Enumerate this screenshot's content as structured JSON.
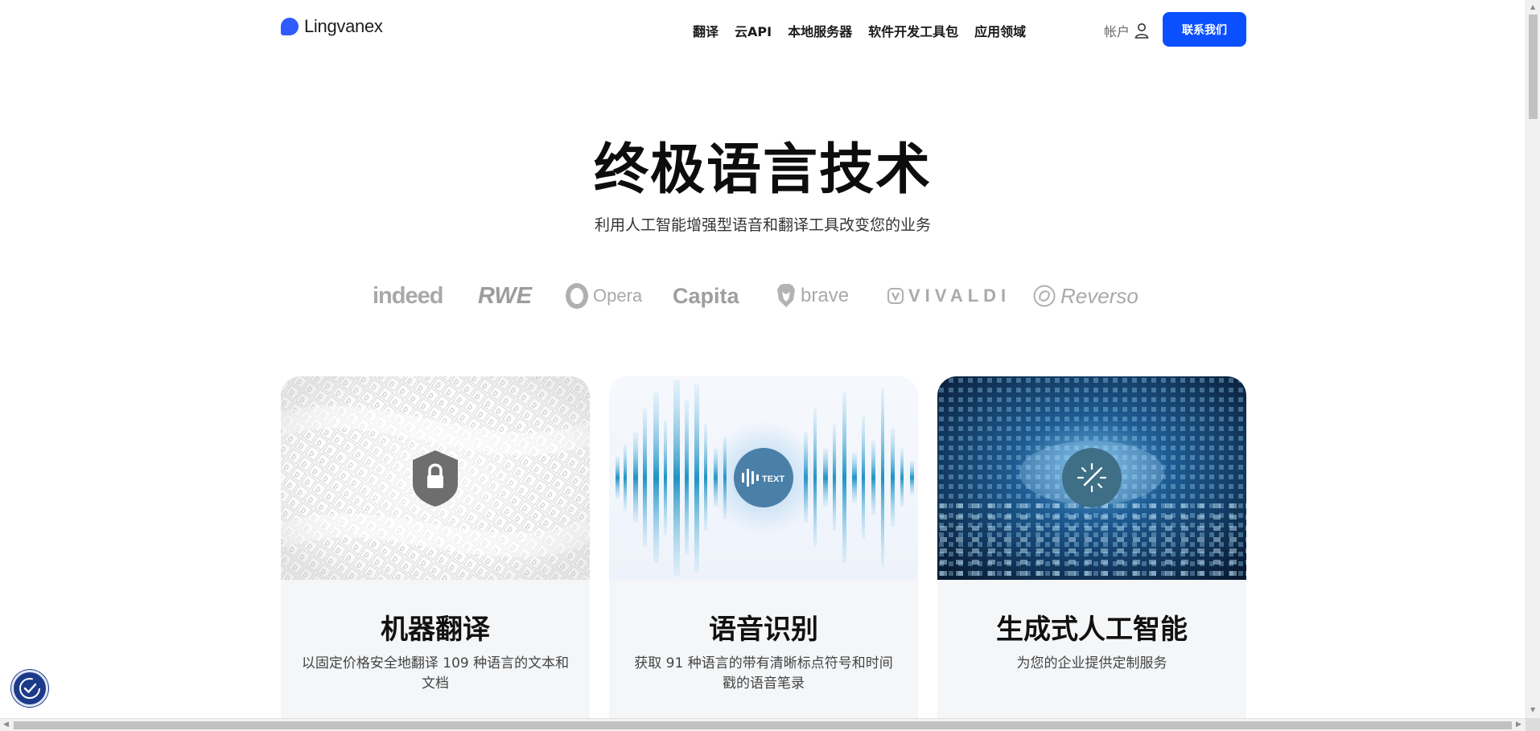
{
  "header": {
    "logo_text": "Lingvanex",
    "nav": [
      "翻译",
      "云API",
      "本地服务器",
      "软件开发工具包",
      "应用领域"
    ],
    "account_label": "帐户",
    "contact_button": "联系我们"
  },
  "hero": {
    "title": "终极语言技术",
    "subtitle": "利用人工智能增强型语音和翻译工具改变您的业务"
  },
  "clients": [
    "indeed",
    "RWE",
    "Opera",
    "Capita",
    "brave",
    "VIVALDI",
    "Reverso"
  ],
  "cards": [
    {
      "title": "机器翻译",
      "description": "以固定价格安全地翻译 109 种语言的文本和文档",
      "badge_icon": "lock-icon"
    },
    {
      "title": "语音识别",
      "description": "获取 91 种语言的带有清晰标点符号和时间戳的语音笔录",
      "badge_icon": "sound-wave-icon",
      "badge_text": "TEXT"
    },
    {
      "title": "生成式人工智能",
      "description": "为您的企业提供定制服务",
      "badge_icon": "magic-wand-icon"
    }
  ],
  "colors": {
    "accent": "#0b50ff",
    "logo": "#2f5bff",
    "card_bg": "#f4f6f8",
    "a11y_button": "#1b3a8a"
  },
  "icons": {
    "account": "user-icon",
    "accessibility": "accessibility-icon"
  }
}
